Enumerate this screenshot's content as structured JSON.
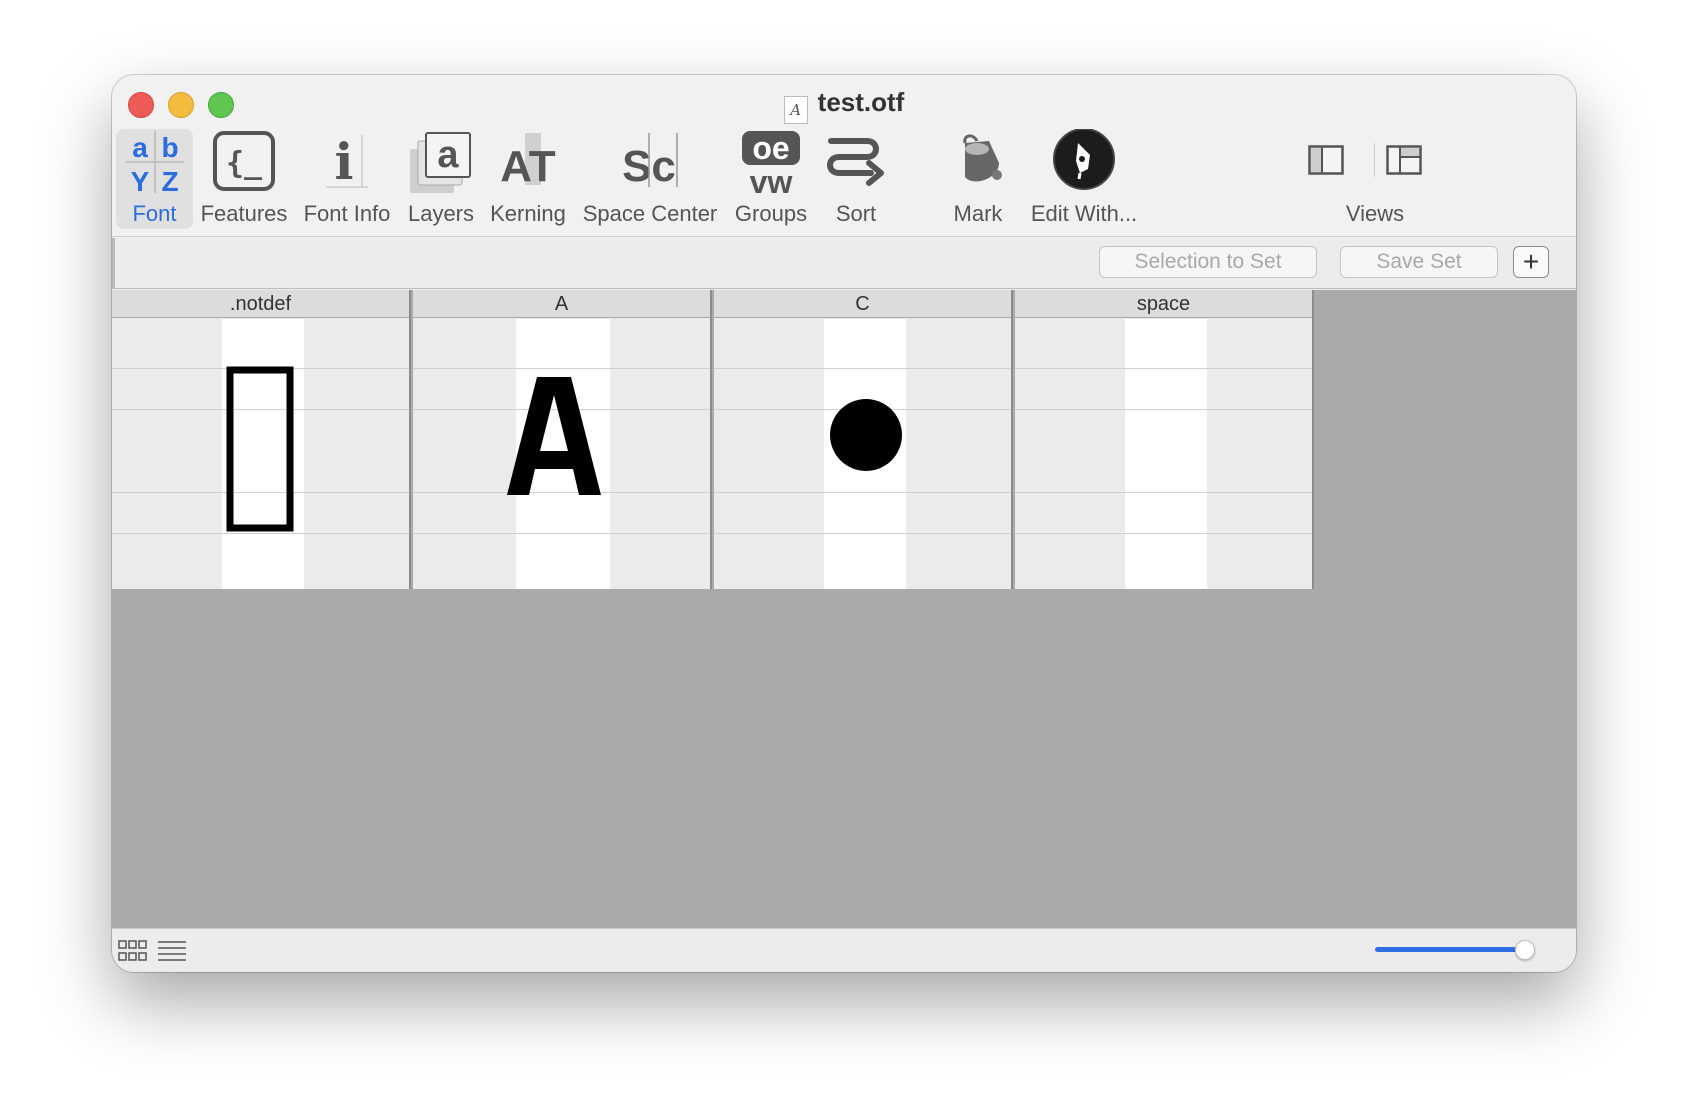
{
  "window": {
    "title": "test.otf",
    "doc_icon_glyph": "A"
  },
  "toolbar": {
    "items": [
      {
        "label": "Font",
        "icon": "font-abyz-icon",
        "active": true
      },
      {
        "label": "Features",
        "icon": "features-braces-icon"
      },
      {
        "label": "Font Info",
        "icon": "font-info-icon"
      },
      {
        "label": "Layers",
        "icon": "layers-icon"
      },
      {
        "label": "Kerning",
        "icon": "kerning-icon"
      },
      {
        "label": "Space Center",
        "icon": "space-center-icon"
      },
      {
        "label": "Groups",
        "icon": "groups-icon"
      },
      {
        "label": "Sort",
        "icon": "sort-icon"
      },
      {
        "label": "Mark",
        "icon": "paint-bucket-icon"
      },
      {
        "label": "Edit With...",
        "icon": "pen-nib-icon"
      },
      {
        "label": "Views",
        "icon": "views-icon"
      }
    ],
    "font_icon_letters": [
      "a",
      "b",
      "Y",
      "Z"
    ],
    "features_icon_text": "{_",
    "font_info_icon_text": "i",
    "layers_icon_text": "a",
    "kerning_icon_text": "AT",
    "space_center_icon_text": "Sc",
    "groups_icon_text_top": "oe",
    "groups_icon_text_bottom": "vw",
    "accent_color": "#2b6cde"
  },
  "setbar": {
    "selection_to_set": "Selection to Set",
    "save_set": "Save Set",
    "add": "+"
  },
  "glyphs": [
    {
      "name": ".notdef"
    },
    {
      "name": "A"
    },
    {
      "name": "C"
    },
    {
      "name": "space"
    }
  ],
  "status": {
    "grid_view_icon": "grid-view-icon",
    "list_view_icon": "list-view-icon",
    "cell_size_value": 1.0
  }
}
